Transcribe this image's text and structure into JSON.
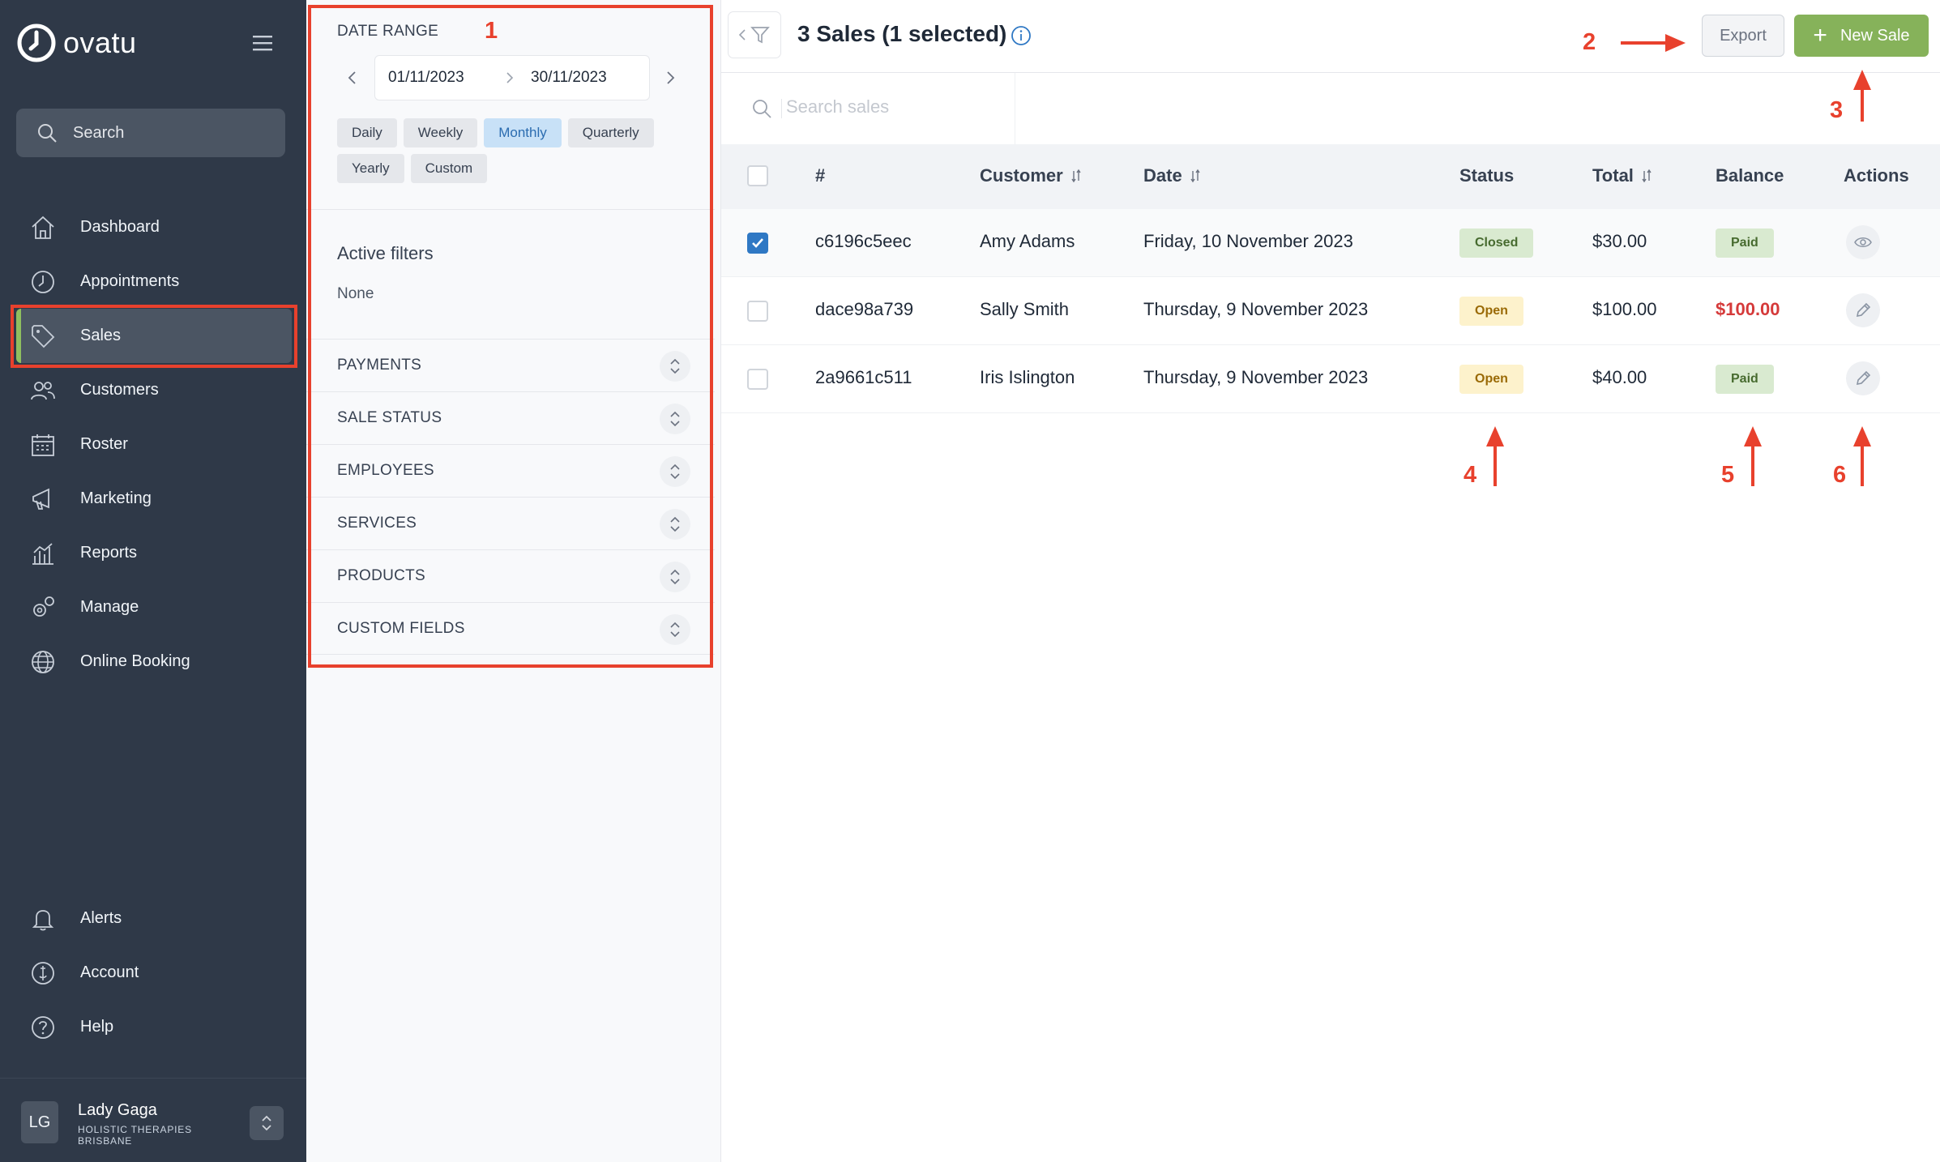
{
  "app": {
    "brand": "ovatu"
  },
  "sidebar": {
    "search_label": "Search",
    "items": [
      {
        "label": "Dashboard",
        "icon": "home-icon"
      },
      {
        "label": "Appointments",
        "icon": "clock-icon"
      },
      {
        "label": "Sales",
        "icon": "tag-icon",
        "active": true
      },
      {
        "label": "Customers",
        "icon": "users-icon"
      },
      {
        "label": "Roster",
        "icon": "calendar-icon"
      },
      {
        "label": "Marketing",
        "icon": "megaphone-icon"
      },
      {
        "label": "Reports",
        "icon": "chart-icon"
      },
      {
        "label": "Manage",
        "icon": "gears-icon"
      },
      {
        "label": "Online Booking",
        "icon": "globe-icon"
      }
    ],
    "bottom_items": [
      {
        "label": "Alerts",
        "icon": "bell-icon"
      },
      {
        "label": "Account",
        "icon": "account-icon"
      },
      {
        "label": "Help",
        "icon": "help-icon"
      }
    ],
    "user": {
      "initials": "LG",
      "name": "Lady Gaga",
      "business": "HOLISTIC THERAPIES BRISBANE"
    }
  },
  "filters": {
    "date_range": {
      "title": "DATE RANGE",
      "start": "01/11/2023",
      "end": "30/11/2023",
      "periods": [
        "Daily",
        "Weekly",
        "Monthly",
        "Quarterly",
        "Yearly",
        "Custom"
      ],
      "active_period": "Monthly"
    },
    "active_filters": {
      "title": "Active filters",
      "value": "None"
    },
    "sections": [
      "PAYMENTS",
      "SALE STATUS",
      "EMPLOYEES",
      "SERVICES",
      "PRODUCTS",
      "CUSTOM FIELDS"
    ]
  },
  "main": {
    "title": "3 Sales (1 selected)",
    "export_label": "Export",
    "new_sale_label": "New Sale",
    "search_placeholder": "Search sales",
    "columns": [
      "#",
      "Customer",
      "Date",
      "Status",
      "Total",
      "Balance",
      "Actions"
    ],
    "rows": [
      {
        "id": "c6196c5eec",
        "customer": "Amy Adams",
        "date": "Friday, 10 November 2023",
        "status": "Closed",
        "total": "$30.00",
        "balance": "Paid",
        "action_icon": "eye-icon",
        "selected": true
      },
      {
        "id": "dace98a739",
        "customer": "Sally Smith",
        "date": "Thursday, 9 November 2023",
        "status": "Open",
        "total": "$100.00",
        "balance": "$100.00",
        "action_icon": "pencil-icon",
        "selected": false
      },
      {
        "id": "2a9661c511",
        "customer": "Iris Islington",
        "date": "Thursday, 9 November 2023",
        "status": "Open",
        "total": "$40.00",
        "balance": "Paid",
        "action_icon": "pencil-icon",
        "selected": false
      }
    ]
  },
  "annotations": [
    "1",
    "2",
    "3",
    "4",
    "5",
    "6"
  ],
  "colors": {
    "sidebar": "#2f3948",
    "accent_green": "#86b25a",
    "annotation_red": "#e8412d",
    "selected_blue": "#2f78c4"
  }
}
